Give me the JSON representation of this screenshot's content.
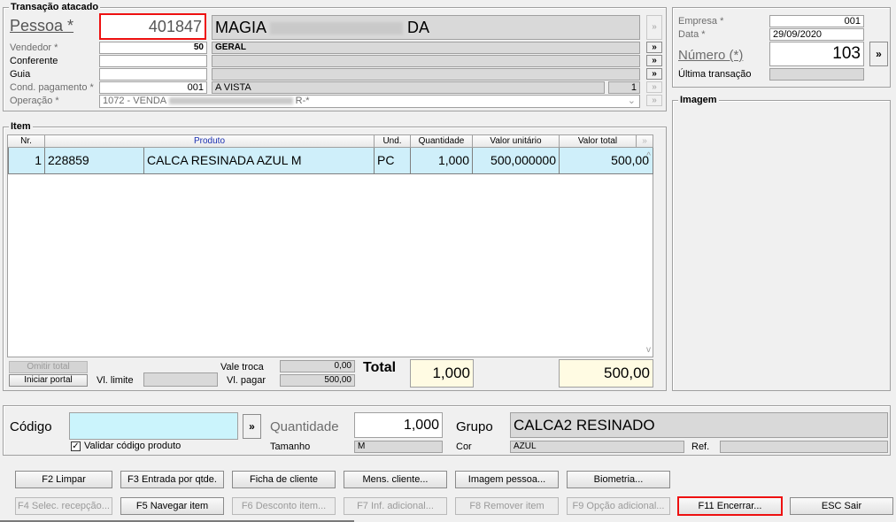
{
  "transacao": {
    "title": "Transação atacado",
    "pessoa_label": "Pessoa *",
    "pessoa_value": "401847",
    "pessoa_nome_a": "MAGIA",
    "pessoa_nome_b": "DA",
    "vendedor_label": "Vendedor *",
    "vendedor_code": "50",
    "vendedor_nome": "GERAL",
    "conferente_label": "Conferente",
    "guia_label": "Guia",
    "cond_label": "Cond. pagamento *",
    "cond_code": "001",
    "cond_nome": "A VISTA",
    "cond_num": "1",
    "operacao_label": "Operação *",
    "operacao_prefix": "1072 - VENDA",
    "operacao_suffix": "R-*"
  },
  "header_right": {
    "empresa_label": "Empresa *",
    "empresa_value": "001",
    "data_label": "Data *",
    "data_value": "29/09/2020",
    "numero_label": "Número (*)",
    "numero_value": "103",
    "ultima_label": "Última transação"
  },
  "imagem": {
    "title": "Imagem"
  },
  "item": {
    "title": "Item",
    "columns": [
      "Nr.",
      "Produto",
      "Und.",
      "Quantidade",
      "Valor unitário",
      "Valor total"
    ],
    "rows": [
      {
        "nr": "1",
        "codigo": "228859",
        "produto": "CALCA RESINADA AZUL M",
        "und": "PC",
        "quantidade": "1,000",
        "unitario": "500,000000",
        "total": "500,00"
      }
    ]
  },
  "totals": {
    "omitir_label": "Omitir total",
    "iniciar_label": "Iniciar portal",
    "vl_limite_label": "Vl. limite",
    "vale_troca_label": "Vale troca",
    "vale_troca_value": "0,00",
    "vl_pagar_label": "Vl. pagar",
    "vl_pagar_value": "500,00",
    "total_label": "Total",
    "total_qtd": "1,000",
    "total_valor": "500,00"
  },
  "entry": {
    "codigo_label": "Código",
    "validar_label": "Validar código produto",
    "quantidade_label": "Quantidade",
    "quantidade_value": "1,000",
    "tamanho_label": "Tamanho",
    "tamanho_value": "M",
    "grupo_label": "Grupo",
    "grupo_value": "CALCA2 RESINADO",
    "cor_label": "Cor",
    "cor_value": "AZUL",
    "ref_label": "Ref."
  },
  "buttons": {
    "f2": "F2 Limpar",
    "f3": "F3 Entrada por qtde.",
    "ficha": "Ficha de cliente",
    "mens": "Mens. cliente...",
    "imagem_pessoa": "Imagem pessoa...",
    "biometria": "Biometria...",
    "f4": "F4 Selec. recepção...",
    "f5": "F5 Navegar item",
    "f6": "F6 Desconto item...",
    "f7": "F7 Inf. adicional...",
    "f8": "F8 Remover item",
    "f9": "F9 Opção adicional...",
    "f11": "F11 Encerrar...",
    "esc": "ESC Sair"
  },
  "glyphs": {
    "double_arrow": "»",
    "ellipsis_arrow": "»",
    "scroll_up": "^",
    "scroll_down": "v",
    "check": "✓"
  }
}
